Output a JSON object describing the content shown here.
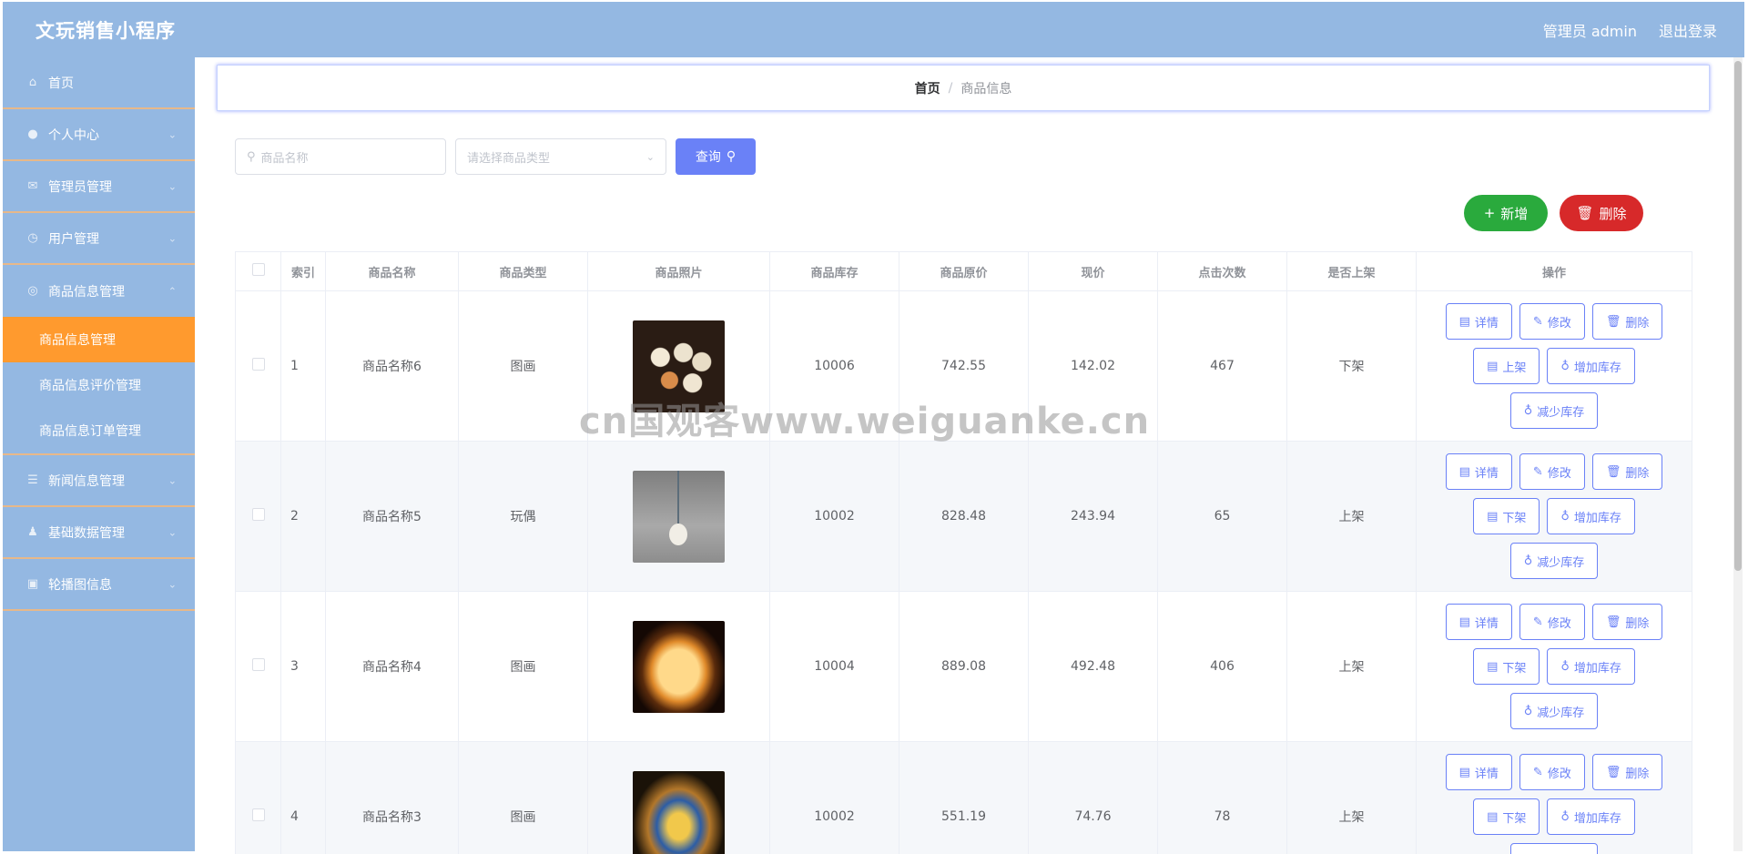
{
  "header": {
    "title": "文玩销售小程序",
    "user": "管理员 admin",
    "logout": "退出登录"
  },
  "sidebar": {
    "items": [
      {
        "label": "首页",
        "icon": "home-icon"
      },
      {
        "label": "个人中心",
        "icon": "user-icon"
      },
      {
        "label": "管理员管理",
        "icon": "mail-icon"
      },
      {
        "label": "用户管理",
        "icon": "clock-icon"
      },
      {
        "label": "商品信息管理",
        "icon": "target-icon"
      }
    ],
    "subitems": [
      {
        "label": "商品信息管理"
      },
      {
        "label": "商品信息评价管理"
      },
      {
        "label": "商品信息订单管理"
      }
    ],
    "items_after": [
      {
        "label": "新闻信息管理",
        "icon": "list-icon"
      },
      {
        "label": "基础数据管理",
        "icon": "person-icon"
      },
      {
        "label": "轮播图信息",
        "icon": "camera-icon"
      }
    ]
  },
  "breadcrumb": {
    "home": "首页",
    "separator": "/",
    "current": "商品信息"
  },
  "search": {
    "name_placeholder": "商品名称",
    "type_placeholder": "请选择商品类型",
    "query_label": "查询"
  },
  "actions": {
    "add_label": "新增",
    "delete_label": "删除"
  },
  "table": {
    "headers": [
      "索引",
      "商品名称",
      "商品类型",
      "商品照片",
      "商品库存",
      "商品原价",
      "现价",
      "点击次数",
      "是否上架",
      "操作"
    ],
    "rows": [
      {
        "index": "1",
        "name": "商品名称6",
        "type": "图画",
        "stock": "10006",
        "price": "742.55",
        "now": "142.02",
        "clicks": "467",
        "status": "下架",
        "toggle": "上架"
      },
      {
        "index": "2",
        "name": "商品名称5",
        "type": "玩偶",
        "stock": "10002",
        "price": "828.48",
        "now": "243.94",
        "clicks": "65",
        "status": "上架",
        "toggle": "下架"
      },
      {
        "index": "3",
        "name": "商品名称4",
        "type": "图画",
        "stock": "10004",
        "price": "889.08",
        "now": "492.48",
        "clicks": "406",
        "status": "上架",
        "toggle": "下架"
      },
      {
        "index": "4",
        "name": "商品名称3",
        "type": "图画",
        "stock": "10002",
        "price": "551.19",
        "now": "74.76",
        "clicks": "78",
        "status": "上架",
        "toggle": "下架"
      }
    ],
    "ops": {
      "detail": "详情",
      "edit": "修改",
      "delete": "删除",
      "add_stock": "增加库存",
      "reduce_stock": "减少库存"
    }
  },
  "watermark": "cn国观客www.weiguanke.cn"
}
